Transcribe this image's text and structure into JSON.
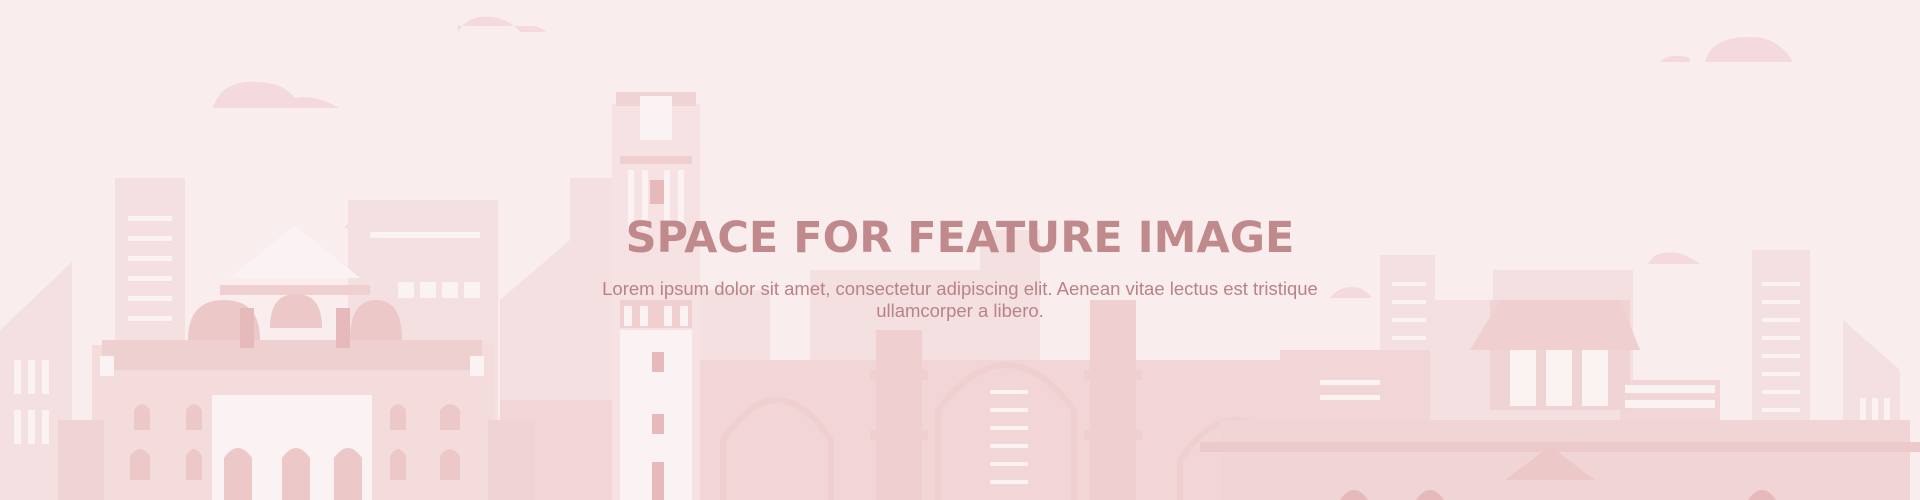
{
  "feature": {
    "title": "SPACE FOR FEATURE IMAGE",
    "subtitle": "Lorem ipsum dolor sit amet, consectetur adipiscing elit. Aenean vitae lectus est tristique ullamcorper a libero."
  },
  "colors": {
    "background": "#f9eded",
    "title": "#c08a8c",
    "subtitle": "#b98286",
    "building_light": "#f4dcdd",
    "building_mid": "#efcfd0",
    "building_dark": "#e6b9bb",
    "highlight": "#fbf3f3"
  }
}
